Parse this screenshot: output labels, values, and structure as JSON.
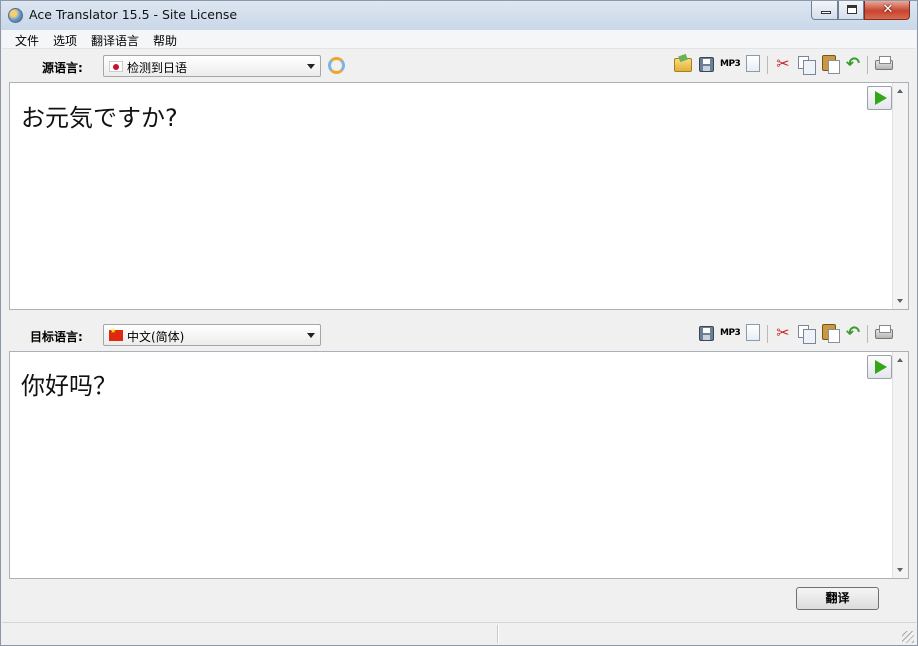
{
  "window": {
    "title": "Ace Translator 15.5 - Site License"
  },
  "menu": {
    "items": [
      "文件",
      "选项",
      "翻译语言",
      "帮助"
    ]
  },
  "source": {
    "label": "源语言:",
    "language": "检测到日语",
    "flag": "japan-flag",
    "text": "お元気ですか?"
  },
  "target": {
    "label": "目标语言:",
    "language": "中文(简体)",
    "flag": "china-flag",
    "text": "你好吗？"
  },
  "toolbar": {
    "mp3_label": "MP3"
  },
  "actions": {
    "translate_label": "翻译"
  },
  "colors": {
    "play": "#35a519",
    "close": "#c8452e"
  }
}
